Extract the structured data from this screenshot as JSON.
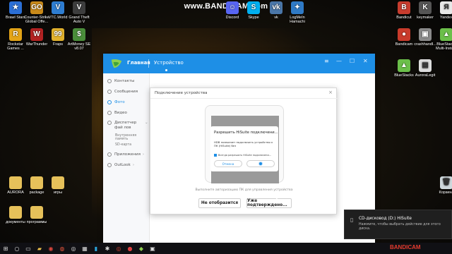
{
  "watermark": "www.BANDICAM.com",
  "desktop_icons": [
    {
      "label": "Brawl Stars",
      "icon": "brawl-stars-icon",
      "color": "#2b6fd6",
      "glyph": "★"
    },
    {
      "label": "Counter-Strike Global Offe...",
      "icon": "csgo-icon",
      "color": "#c98a1a",
      "glyph": "GO"
    },
    {
      "label": "VTC.World",
      "icon": "vtc-world-icon",
      "color": "#2e7dd1",
      "glyph": "V"
    },
    {
      "label": "Grand Theft Auto V",
      "icon": "gta-icon",
      "color": "#3d3d3d",
      "glyph": "V"
    },
    {
      "label": "Discord",
      "icon": "discord-icon",
      "color": "#5865f2",
      "glyph": "☺"
    },
    {
      "label": "Skype",
      "icon": "skype-icon",
      "color": "#00aff0",
      "glyph": "S"
    },
    {
      "label": "vk",
      "icon": "vk-icon",
      "color": "#4a76a8",
      "glyph": "vk"
    },
    {
      "label": "LogMeIn Hamachi",
      "icon": "hamachi-icon",
      "color": "#2f7ac6",
      "glyph": "✦"
    },
    {
      "label": "Bandicut",
      "icon": "bandicut-icon",
      "color": "#c73c2e",
      "glyph": "B"
    },
    {
      "label": "keymaker",
      "icon": "keymaker-icon",
      "color": "#555555",
      "glyph": "K"
    },
    {
      "label": "Yandex",
      "icon": "yandex-icon",
      "color": "#e8e8e8",
      "glyph": "Я"
    },
    {
      "label": "Rockstar Games ...",
      "icon": "rockstar-icon",
      "color": "#e3a417",
      "glyph": "R"
    },
    {
      "label": "WarThunder",
      "icon": "warthunder-icon",
      "color": "#b22222",
      "glyph": "W"
    },
    {
      "label": "Fraps",
      "icon": "fraps-icon",
      "color": "#e1b12c",
      "glyph": "99"
    },
    {
      "label": "ArtMoney SE v8.07",
      "icon": "artmoney-icon",
      "color": "#4a8d3a",
      "glyph": "$"
    },
    {
      "label": "Bandicam",
      "icon": "bandicam-icon",
      "color": "#c93b2b",
      "glyph": "●"
    },
    {
      "label": "crashhandl...",
      "icon": "crashhandler-icon",
      "color": "#8a8a8a",
      "glyph": "▣"
    },
    {
      "label": "BlueStacks Multi-Insta...",
      "icon": "bluestacks-multi-icon",
      "color": "#6bbf4a",
      "glyph": "▲"
    },
    {
      "label": "BlueStacks",
      "icon": "bluestacks-icon",
      "color": "#6bbf4a",
      "glyph": "▲"
    },
    {
      "label": "AuroraLegit",
      "icon": "auroralegit-icon",
      "color": "#dddddd",
      "glyph": "▤"
    },
    {
      "label": "AURORA",
      "icon": "aurora-folder-icon",
      "color": "#e6c15a",
      "glyph": ""
    },
    {
      "label": "package",
      "icon": "package-folder-icon",
      "color": "#e6c15a",
      "glyph": ""
    },
    {
      "label": "игры",
      "icon": "games-folder-icon",
      "color": "#e6c15a",
      "glyph": ""
    },
    {
      "label": "документы",
      "icon": "documents-folder-icon",
      "color": "#e6c15a",
      "glyph": ""
    },
    {
      "label": "программы",
      "icon": "programs-folder-icon",
      "color": "#e6c15a",
      "glyph": ""
    },
    {
      "label": "Корзина",
      "icon": "recycle-bin-icon",
      "color": "#cfd8dc",
      "glyph": "🗑"
    }
  ],
  "hisuite": {
    "nav_home": "Главная",
    "nav_device": "Устройство",
    "controls": {
      "menu": "≡",
      "minimize": "—",
      "maximize": "☐",
      "close": "✕"
    },
    "sidebar": [
      {
        "label": "Контакты"
      },
      {
        "label": "Сообщения"
      },
      {
        "label": "Фото",
        "active": true
      },
      {
        "label": "Видео"
      },
      {
        "label": "Диспетчер фай лов"
      },
      {
        "label": "Внутренняя память",
        "sub": true
      },
      {
        "label": "SD-карта",
        "sub": true
      },
      {
        "label": "Приложения"
      },
      {
        "label": "OutLook"
      }
    ]
  },
  "dialog": {
    "title": "Подключение устройства",
    "close": "×",
    "phone_dialog": {
      "title": "Разрешить HiSuite подключени...",
      "text": "HDB позволяет подключить устройство к ПК (HiSuite) без",
      "checkbox": "Всегда разрешать HiSuite подключени...",
      "cancel": "Отмена"
    },
    "hint": "Выполните авторизацию ПК для управления устройства",
    "btn_not_shown": "Не отобразится",
    "btn_confirmed": "Уже подтверждено..."
  },
  "toast": {
    "title": "CD-дисковод (D:) HiSuite",
    "text": "Нажмите, чтобы выбрать действие для этого диска."
  },
  "taskbar": {
    "items": [
      "start-icon",
      "search-icon",
      "task-view-icon",
      "explorer-icon",
      "chrome-icon",
      "browser-icon",
      "steam-icon",
      "app-icon",
      "app-icon",
      "bandicam-taskbar-icon",
      "record-icon",
      "hisuite-taskbar-icon",
      "app-icon"
    ],
    "bandicam_mark": "BANDICAM"
  }
}
